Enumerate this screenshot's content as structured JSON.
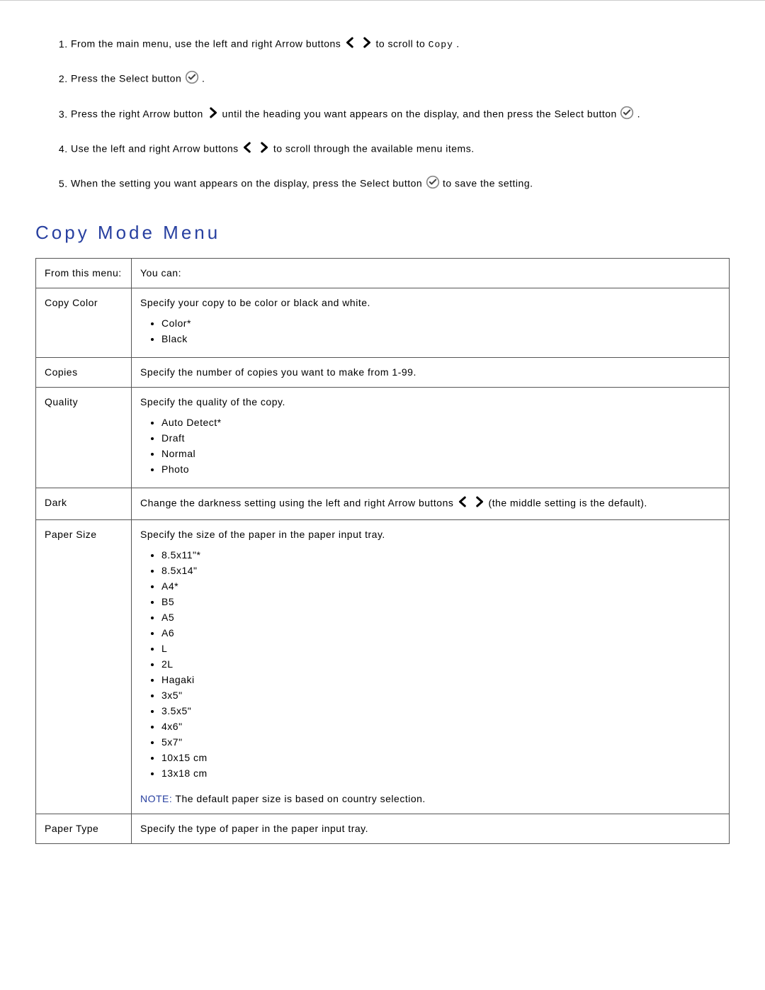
{
  "steps": [
    {
      "pre": "From the main menu, use the left and right Arrow buttons ",
      "post": " to scroll to ",
      "mono": "Copy",
      "tail": ".",
      "icons": "arrows"
    },
    {
      "pre": "Press the Select button ",
      "post": " .",
      "icons": "select"
    },
    {
      "pre": "Press the right Arrow button ",
      "mid": " until the heading you want appears on the display, and then press the Select button ",
      "post": " .",
      "icons": "right-then-select"
    },
    {
      "pre": "Use the left and right Arrow buttons ",
      "post": " to scroll through the available menu items.",
      "icons": "arrows"
    },
    {
      "pre": "When the setting you want appears on the display, press the Select button ",
      "post": " to save the setting.",
      "icons": "select"
    }
  ],
  "section_title": "Copy Mode Menu",
  "table": {
    "header": {
      "left": "From this menu:",
      "right": "You can:"
    },
    "rows": [
      {
        "left": "Copy Color",
        "right_text": "Specify your copy to be color or black and white.",
        "options": [
          "Color*",
          "Black"
        ]
      },
      {
        "left": "Copies",
        "right_text": "Specify the number of copies you want to make from 1-99."
      },
      {
        "left": "Quality",
        "right_text": "Specify the quality of the copy.",
        "options": [
          "Auto Detect*",
          "Draft",
          "Normal",
          "Photo"
        ]
      },
      {
        "left": "Dark",
        "right_text_pre": "Change the darkness setting using the left and right Arrow buttons ",
        "right_text_post": " (the middle setting is the default).",
        "inline_arrows": true
      },
      {
        "left": "Paper Size",
        "right_text": "Specify the size of the paper in the paper input tray.",
        "options": [
          "8.5x11\"*",
          "8.5x14\"",
          "A4*",
          "B5",
          "A5",
          "A6",
          "L",
          "2L",
          "Hagaki",
          "3x5\"",
          "3.5x5\"",
          "4x6\"",
          "5x7\"",
          "10x15 cm",
          "13x18 cm"
        ],
        "note_label": "NOTE:",
        "note_text": " The default paper size is based on country selection."
      },
      {
        "left": "Paper Type",
        "right_text": "Specify the type of paper in the paper input tray."
      }
    ]
  }
}
